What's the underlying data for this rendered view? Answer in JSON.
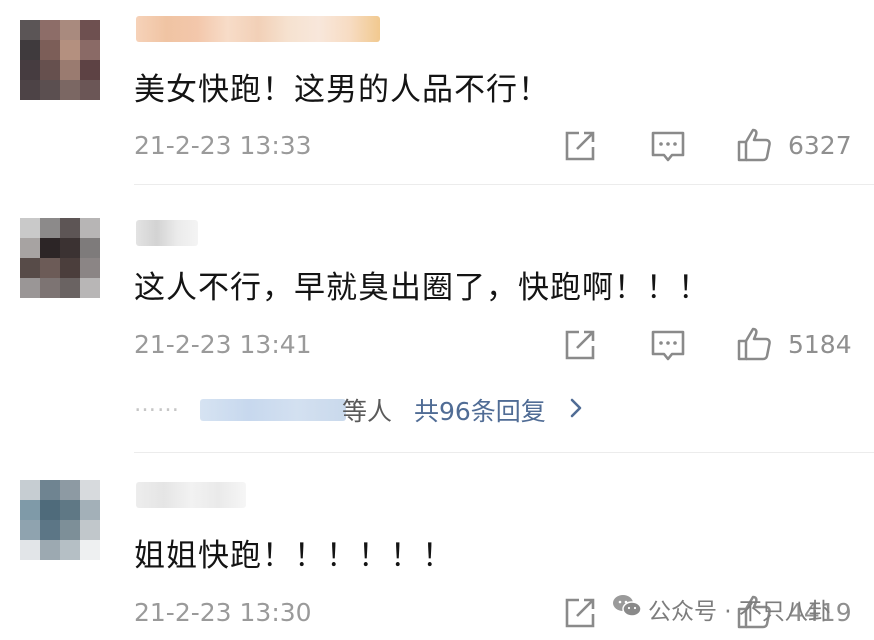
{
  "comments": [
    {
      "text": "美女快跑！这男的人品不行！",
      "time": "21-2-23 13:33",
      "likes": "6327",
      "avatar_colors": [
        "#5b5556",
        "#8d6d68",
        "#a98a7e",
        "#6e5050",
        "#3f3a3d",
        "#7c5e58",
        "#b4907f",
        "#8a6a66",
        "#463c40",
        "#66504e",
        "#9a7b70",
        "#5d4244",
        "#4d4346",
        "#5b4f50",
        "#7b6763",
        "#6b5656"
      ],
      "username_colors": [
        "#f6d2b9",
        "#f0c4a3",
        "#f3c7ab",
        "#f7dcc8",
        "#f2d0b7",
        "#f6e2d0",
        "#f8e7db",
        "#f7dcc3",
        "#f1c98f"
      ]
    },
    {
      "text": "这人不行，早就臭出圈了，快跑啊！！！",
      "time": "21-2-23 13:41",
      "likes": "5184",
      "avatar_colors": [
        "#c9c9c9",
        "#8c8a8a",
        "#5d5555",
        "#b7b5b5",
        "#a7a3a2",
        "#2c2526",
        "#3b3232",
        "#7e7b7b",
        "#574b48",
        "#6c5b57",
        "#4b3e3c",
        "#8b8585",
        "#9a9696",
        "#7d7473",
        "#6a6362",
        "#b8b6b6"
      ],
      "username_colors": [
        "#e3e3e3",
        "#d3d3d3",
        "#ebebeb",
        "#f4f4f4"
      ]
    },
    {
      "text": "姐姐快跑！！！！！！",
      "time": "21-2-23 13:30",
      "likes": "4419",
      "avatar_colors": [
        "#c6cdd2",
        "#6f8491",
        "#8d9aa3",
        "#d7dadd",
        "#7f9aa8",
        "#4f6b7b",
        "#5f7885",
        "#a3b0b8",
        "#8fa3af",
        "#5c7686",
        "#7d8f98",
        "#c1c7cb",
        "#e2e5e8",
        "#9ca9b1",
        "#b5bfc5",
        "#eef0f1"
      ],
      "username_colors": [
        "#ededed",
        "#e5e5e5",
        "#f2f2f2",
        "#eaeaea",
        "#f6f6f6"
      ]
    }
  ],
  "replies": {
    "dots": "……",
    "suffix": "等人",
    "count_label": "共96条回复"
  },
  "watermark": {
    "text": "公众号 · 不只八卦"
  },
  "icons": {
    "share": "share-icon",
    "comment": "comment-icon",
    "like": "like-icon",
    "chevron": "chevron-right-icon",
    "wechat": "wechat-icon"
  }
}
